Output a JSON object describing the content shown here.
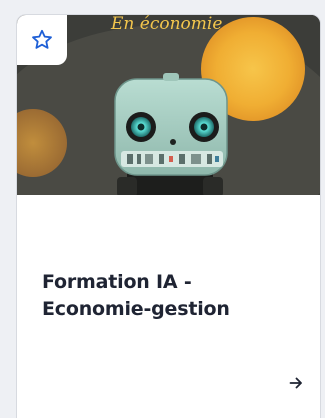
{
  "card": {
    "cover_caption": "En économie",
    "title_line1": "Formation IA -",
    "title_line2": "Economie-gestion",
    "favorite_icon": "star-outline-icon",
    "open_icon": "arrow-right-icon"
  },
  "colors": {
    "star_stroke": "#1e5fd6",
    "title_text": "#1f2433",
    "sun": "#f2b63a",
    "robot_body": "#a8cfc4",
    "robot_eyes": "#4fe0d6"
  }
}
